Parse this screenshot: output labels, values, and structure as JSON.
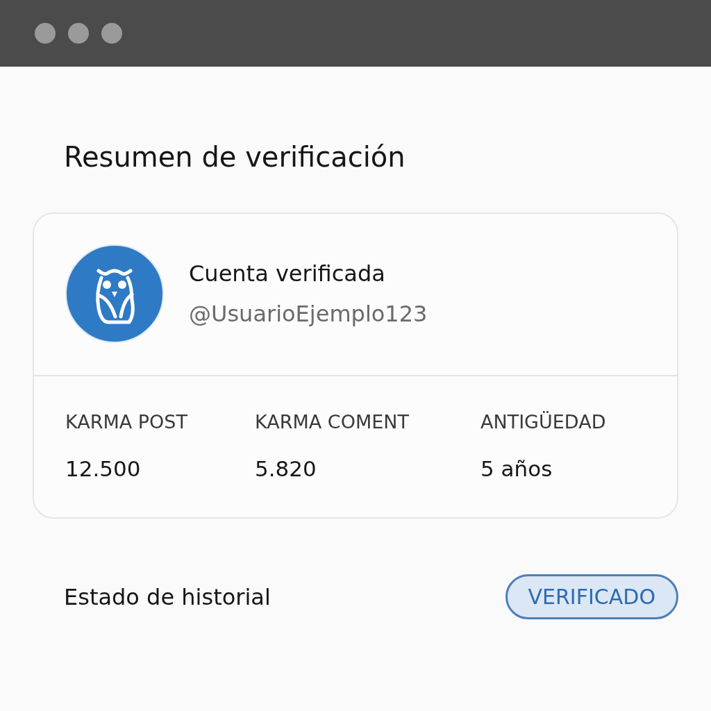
{
  "title": "Resumen de verificación",
  "account": {
    "name": "Cuenta verificada",
    "handle": "@UsuarioEjemplo123"
  },
  "stats": [
    {
      "label": "KARMA POST",
      "value": "12.500"
    },
    {
      "label": "KARMA COMENT",
      "value": "5.820"
    },
    {
      "label": "ANTIGÜEDAD",
      "value": "5 años"
    }
  ],
  "history": {
    "label": "Estado de historial",
    "badge": "VERIFICADO"
  }
}
